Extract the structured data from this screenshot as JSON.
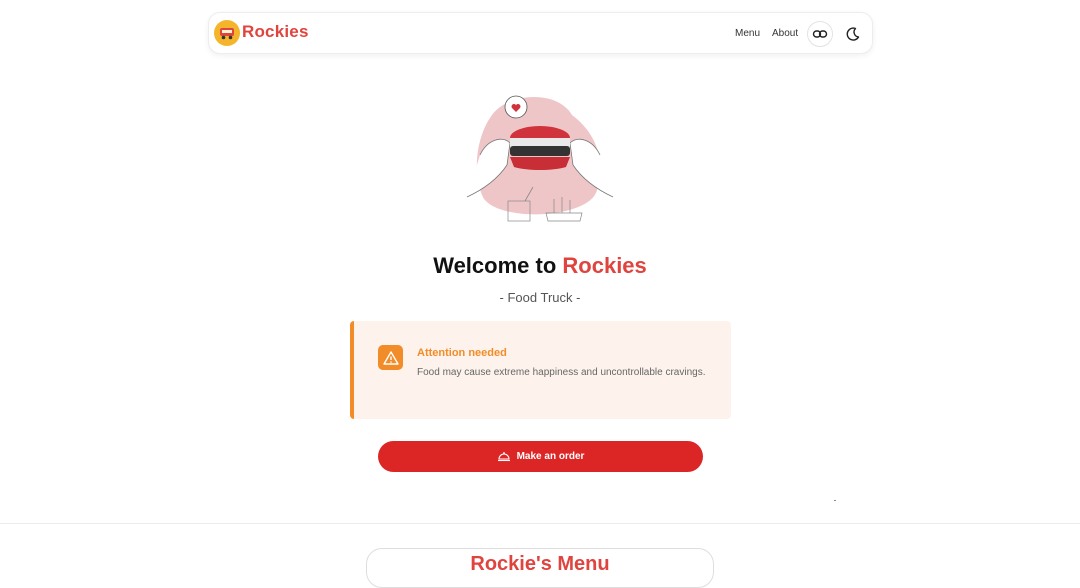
{
  "header": {
    "brand": "Rockies",
    "nav": [
      {
        "label": "Menu"
      },
      {
        "label": "About"
      }
    ],
    "icons": [
      "link-icon",
      "moon-icon"
    ]
  },
  "hero": {
    "title_prefix": "Welcome to ",
    "title_accent": "Rockies",
    "subtitle": "- Food Truck -"
  },
  "alert": {
    "title": "Attention needed",
    "text": "Food may cause extreme happiness and uncontrollable cravings."
  },
  "cta": {
    "label": "Make an order",
    "icon": "food-tray-icon"
  },
  "next_section": {
    "title": "Rockie's Menu"
  },
  "colors": {
    "brand": "#e0443e",
    "accent_orange": "#f28c28",
    "button_red": "#dc2626",
    "alert_bg": "#fdf3ec",
    "logo_yellow": "#f4b52a"
  }
}
